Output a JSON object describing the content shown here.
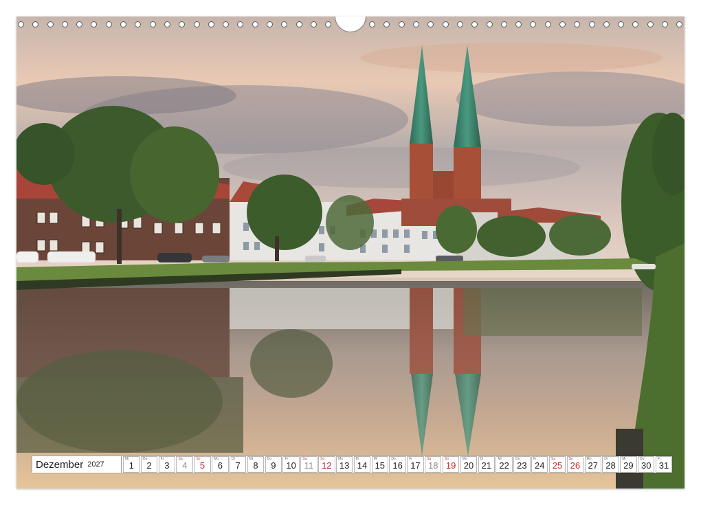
{
  "calendar": {
    "month": "Dezember",
    "year": "2027",
    "days": [
      {
        "abbr": "Mi",
        "num": "1",
        "type": "weekday"
      },
      {
        "abbr": "Do",
        "num": "2",
        "type": "weekday"
      },
      {
        "abbr": "Fr",
        "num": "3",
        "type": "weekday"
      },
      {
        "abbr": "Sa",
        "num": "4",
        "type": "sat"
      },
      {
        "abbr": "So",
        "num": "5",
        "type": "sun"
      },
      {
        "abbr": "Mo",
        "num": "6",
        "type": "weekday"
      },
      {
        "abbr": "Di",
        "num": "7",
        "type": "weekday"
      },
      {
        "abbr": "Mi",
        "num": "8",
        "type": "weekday"
      },
      {
        "abbr": "Do",
        "num": "9",
        "type": "weekday"
      },
      {
        "abbr": "Fr",
        "num": "10",
        "type": "weekday"
      },
      {
        "abbr": "Sa",
        "num": "11",
        "type": "sat"
      },
      {
        "abbr": "So",
        "num": "12",
        "type": "sun"
      },
      {
        "abbr": "Mo",
        "num": "13",
        "type": "weekday"
      },
      {
        "abbr": "Di",
        "num": "14",
        "type": "weekday"
      },
      {
        "abbr": "Mi",
        "num": "15",
        "type": "weekday"
      },
      {
        "abbr": "Do",
        "num": "16",
        "type": "weekday"
      },
      {
        "abbr": "Fr",
        "num": "17",
        "type": "weekday"
      },
      {
        "abbr": "Sa",
        "num": "18",
        "type": "sat"
      },
      {
        "abbr": "So",
        "num": "19",
        "type": "sun"
      },
      {
        "abbr": "Mo",
        "num": "20",
        "type": "weekday"
      },
      {
        "abbr": "Di",
        "num": "21",
        "type": "weekday"
      },
      {
        "abbr": "Mi",
        "num": "22",
        "type": "weekday"
      },
      {
        "abbr": "Do",
        "num": "23",
        "type": "weekday"
      },
      {
        "abbr": "Fr",
        "num": "24",
        "type": "weekday"
      },
      {
        "abbr": "Sa",
        "num": "25",
        "type": "holiday"
      },
      {
        "abbr": "So",
        "num": "26",
        "type": "holiday"
      },
      {
        "abbr": "Mo",
        "num": "27",
        "type": "weekday"
      },
      {
        "abbr": "Di",
        "num": "28",
        "type": "weekday"
      },
      {
        "abbr": "Mi",
        "num": "29",
        "type": "weekday"
      },
      {
        "abbr": "Do",
        "num": "30",
        "type": "weekday"
      },
      {
        "abbr": "Fr",
        "num": "31",
        "type": "weekday"
      }
    ]
  },
  "colors": {
    "spire_green": "#3f8670",
    "brick_red": "#a8503a",
    "holiday_red": "#c8262b",
    "sky_top": "#c9b7ad",
    "water": "#9a8a80"
  }
}
